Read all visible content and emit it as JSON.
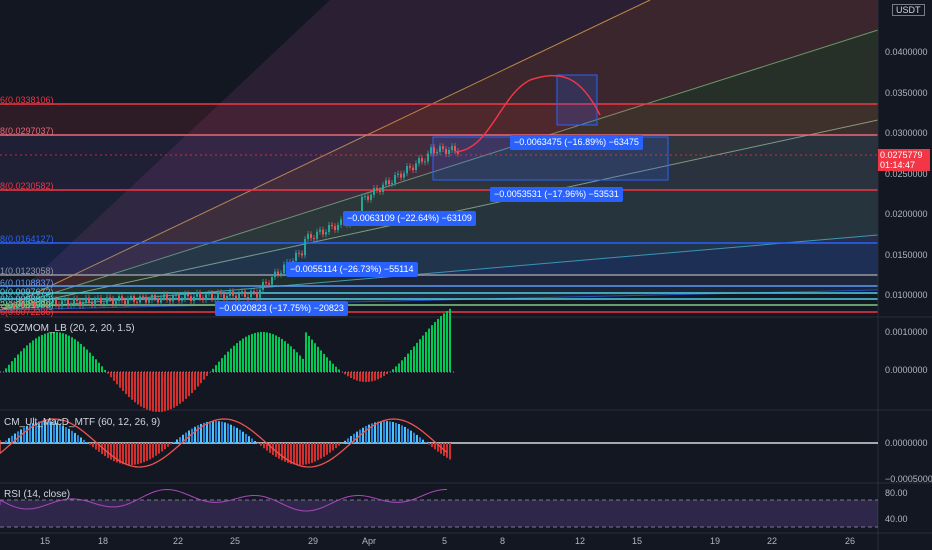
{
  "currency_badge": "USDT",
  "price_axis": [
    "0.0400000",
    "0.0350000",
    "0.0300000",
    "0.0250000",
    "0.0200000",
    "0.0150000",
    "0.0100000"
  ],
  "current_price": {
    "value": "0.0275779",
    "countdown": "01:14:47"
  },
  "fib_levels": [
    {
      "label": "6(0.0338106)",
      "color": "#f23645"
    },
    {
      "label": "8(0.0297037)",
      "color": "#e8697a"
    },
    {
      "label": "8(0.0230582)",
      "color": "#f23645"
    },
    {
      "label": "8(0.0164127)",
      "color": "#2962ff"
    },
    {
      "label": "1(0.0123058)",
      "color": "#9598a1"
    },
    {
      "label": "6(0.0108837)",
      "color": "#5b9cf6"
    },
    {
      "label": "0(0.0097672)",
      "color": "#4dd0e1"
    },
    {
      "label": "8(0.0088833)",
      "color": "#4dd0e1"
    },
    {
      "label": "2(0.0081989)",
      "color": "#81c784"
    },
    {
      "label": "6(0.0072286)",
      "color": "#f23645"
    }
  ],
  "measurements": [
    "−0.0063475 (−16.89%) −63475",
    "−0.0053531 (−17.96%) −53531",
    "−0.0063109 (−22.64%) −63109",
    "−0.0055114 (−26.73%) −55114",
    "−0.0020823 (−17.75%) −20823"
  ],
  "panes": {
    "sqzmom": {
      "title": "SQZMOM_LB (20, 2, 20, 1.5)",
      "axis": [
        "0.0010000",
        "0.0000000"
      ]
    },
    "macd": {
      "title": "CM_Ult_MacD_MTF (60, 12, 26, 9)",
      "axis": [
        "0.0000000",
        "−0.0005000"
      ]
    },
    "rsi": {
      "title": "RSI (14, close)",
      "axis": [
        "80.00",
        "40.00"
      ]
    }
  },
  "time_axis": [
    "15",
    "18",
    "22",
    "25",
    "29",
    "Apr",
    "5",
    "8",
    "12",
    "15",
    "19",
    "22",
    "26"
  ],
  "colors": {
    "bg": "#131722",
    "up": "#26a69a",
    "down": "#ef5350",
    "accent": "#2962ff"
  }
}
